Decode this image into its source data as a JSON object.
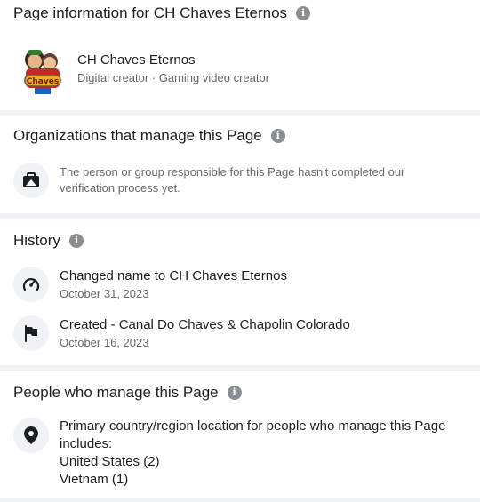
{
  "page_info": {
    "title": "Page information for CH Chaves Eternos",
    "page_name": "CH Chaves Eternos",
    "page_category": "Digital creator · Gaming video creator",
    "avatar_logo_text": "Chaves"
  },
  "organizations": {
    "title": "Organizations that manage this Page",
    "description": "The person or group responsible for this Page hasn't completed our verification process yet."
  },
  "history": {
    "title": "History",
    "items": [
      {
        "label": "Changed name to CH Chaves Eternos",
        "date": "October 31, 2023",
        "icon": "speedometer-icon"
      },
      {
        "label": "Created - Canal Do Chaves & Chapolin Colorado",
        "date": "October 16, 2023",
        "icon": "flag-icon"
      }
    ]
  },
  "people": {
    "title": "People who manage this Page",
    "location_text": "Primary country/region location for people who manage this Page includes:",
    "countries": [
      "United States (2)",
      "Vietnam (1)"
    ]
  },
  "colors": {
    "background": "#f0f2f5",
    "card": "#ffffff",
    "secondary_text": "#65676b",
    "info_icon": "#8a8d91"
  }
}
